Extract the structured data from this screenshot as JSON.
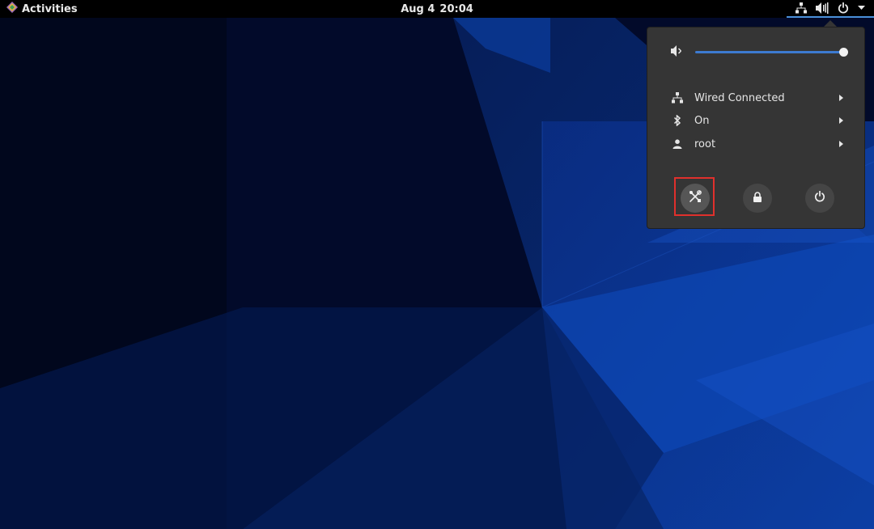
{
  "topbar": {
    "activities_label": "Activities",
    "clock_date": "Aug 4",
    "clock_time": "20:04",
    "status_icons": [
      "network-wired-icon",
      "volume-icon",
      "power-icon",
      "dropdown-arrow-icon"
    ]
  },
  "system_menu": {
    "volume": {
      "icon": "speaker-icon",
      "level_fraction": 1.0
    },
    "items": [
      {
        "icon": "network-wired-icon",
        "label": "Wired Connected"
      },
      {
        "icon": "bluetooth-icon",
        "label": "On"
      },
      {
        "icon": "user-icon",
        "label": "root"
      }
    ],
    "actions": [
      {
        "name": "settings",
        "icon": "settings-tools-icon",
        "highlighted": true
      },
      {
        "name": "lock",
        "icon": "lock-icon",
        "highlighted": false
      },
      {
        "name": "power-off",
        "icon": "power-icon",
        "highlighted": false
      }
    ]
  },
  "colors": {
    "topbar_bg": "#000000",
    "menu_bg": "#353535",
    "accent": "#3d7bd1",
    "highlight_box": "#e0302c"
  }
}
